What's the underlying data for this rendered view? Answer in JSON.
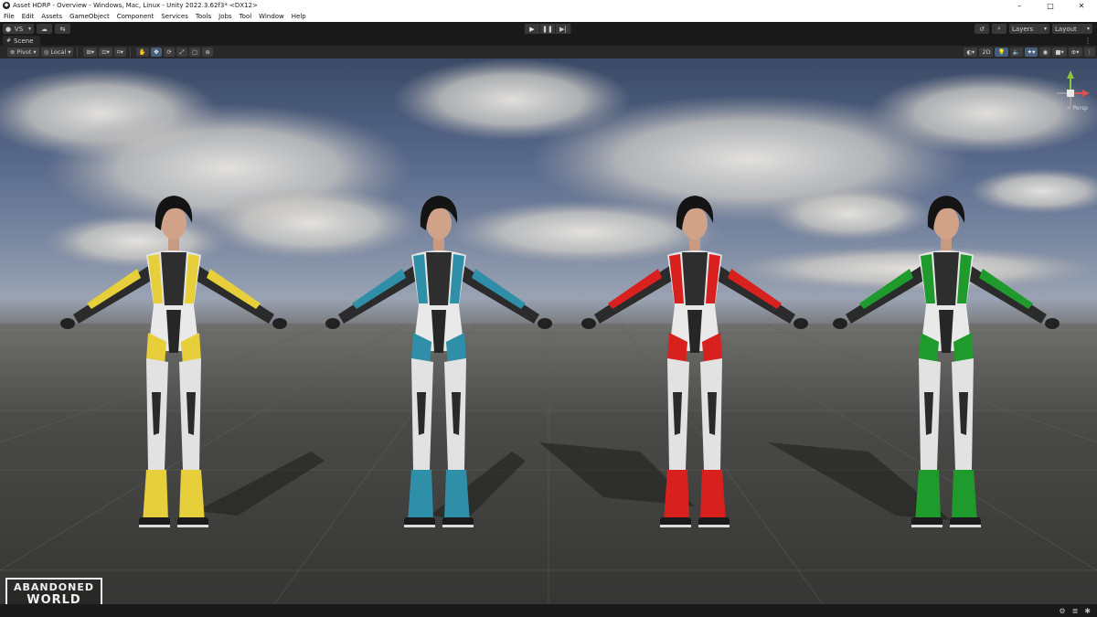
{
  "window": {
    "title": "Asset HDRP - Overview - Windows, Mac, Linux - Unity 2022.3.62f3* <DX12>",
    "controls": [
      "minimize-icon",
      "maximize-icon",
      "close-icon"
    ]
  },
  "menu": {
    "items": [
      "File",
      "Edit",
      "Assets",
      "GameObject",
      "Component",
      "Services",
      "Tools",
      "Jobs",
      "Tool",
      "Window",
      "Help"
    ]
  },
  "toolbar": {
    "account_label": "VS",
    "layers_label": "Layers",
    "layout_label": "Layout"
  },
  "scene": {
    "tab_label": "Scene",
    "pivot_label": "Pivot",
    "local_label": "Local",
    "mode_2d_label": "2D",
    "gizmo_label": "≺ Persp"
  },
  "characters": [
    {
      "name": "character-yellow",
      "accent": "#e6cf3a"
    },
    {
      "name": "character-blue",
      "accent": "#2f8fa8"
    },
    {
      "name": "character-red",
      "accent": "#d8201e"
    },
    {
      "name": "character-green",
      "accent": "#1f9a2c"
    }
  ],
  "logo": {
    "line1": "ABANDONED",
    "line2": "WORLD"
  },
  "colors": {
    "editor_dark": "#191919",
    "panel": "#282828",
    "active_tool": "#46607c"
  }
}
